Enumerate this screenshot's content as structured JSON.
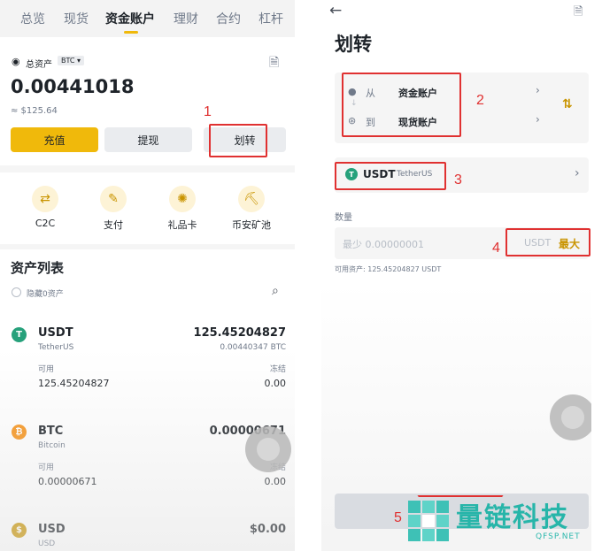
{
  "left": {
    "tabs": [
      "总览",
      "现货",
      "资金账户",
      "理财",
      "合约",
      "杠杆"
    ],
    "overview": {
      "label": "总资产",
      "unit": "BTC",
      "balance": "0.00441018",
      "fiat": "≈ $125.64"
    },
    "buttons": {
      "deposit": "充值",
      "withdraw": "提现",
      "transfer": "划转"
    },
    "quick": [
      "C2C",
      "支付",
      "礼品卡",
      "币安矿池"
    ],
    "asset_list": {
      "title": "资产列表",
      "hide_zero": "隐藏0资产"
    },
    "assets": [
      {
        "symbol": "USDT",
        "name": "TetherUS",
        "amount": "125.45204827",
        "btc_value": "0.00440347 BTC",
        "available_label": "可用",
        "available": "125.45204827",
        "frozen_label": "冻结",
        "frozen": "0.00",
        "icon": "tether-icon",
        "color": "#26a17b"
      },
      {
        "symbol": "BTC",
        "name": "Bitcoin",
        "amount": "0.00000671",
        "btc_value": "",
        "available_label": "可用",
        "available": "0.00000671",
        "frozen_label": "冻结",
        "frozen": "0.00",
        "icon": "bitcoin-icon",
        "color": "#f7931a"
      },
      {
        "symbol": "USD",
        "name": "USD",
        "amount": "$0.00",
        "icon": "dollar-icon",
        "color": "#c99400"
      }
    ]
  },
  "right": {
    "title": "划转",
    "from_label": "从",
    "from_account": "资金账户",
    "to_label": "到",
    "to_account": "现货账户",
    "coin_symbol": "USDT",
    "coin_name": "TetherUS",
    "quantity_label": "数量",
    "quantity_placeholder": "最少 0.00000001",
    "quantity_unit": "USDT",
    "max_label": "最大",
    "available_text": "可用资产: 125.45204827 USDT"
  },
  "annotations": [
    "1",
    "2",
    "3",
    "4",
    "5"
  ],
  "watermark": {
    "title": "量链科技",
    "url": "QFSP.NET"
  },
  "colors": {
    "accent": "#f0b90b",
    "highlight": "#e03131",
    "text": "#1e2329",
    "muted": "#707a8a"
  }
}
